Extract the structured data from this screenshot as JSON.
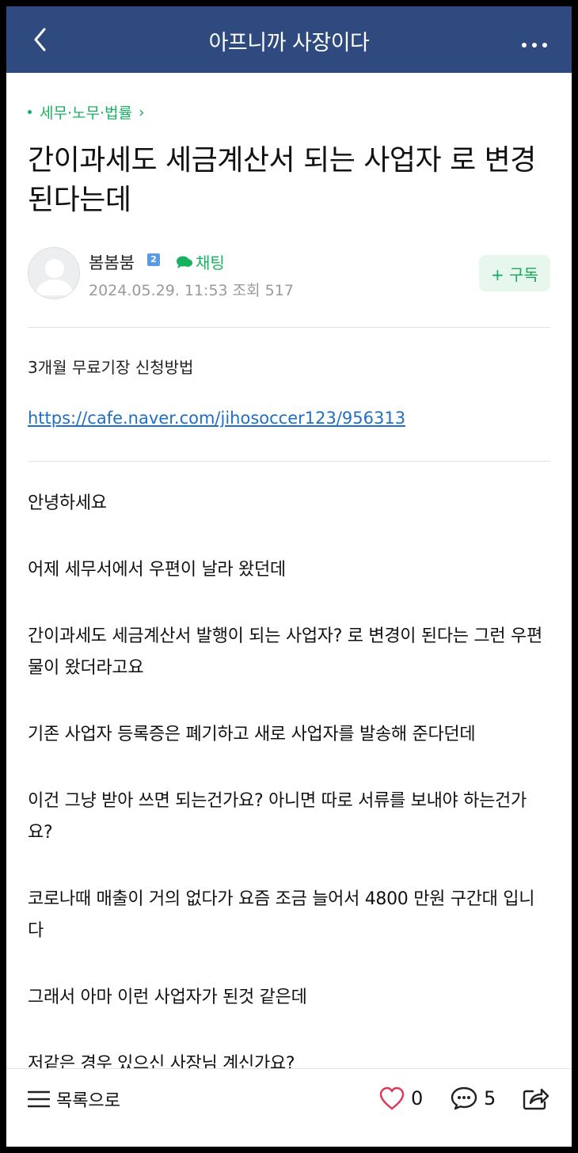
{
  "header": {
    "title": "아프니까 사장이다",
    "back_icon": "chevron-left-icon",
    "more_icon": "more-horizontal-icon",
    "bg_color": "#2f4a7e"
  },
  "post": {
    "category": "세무·노무·법률",
    "title": "간이과세도 세금계산서 되는 사업자 로 변경된다는데",
    "author": {
      "name": "봄봄붐",
      "level": "2",
      "chat_label": "채팅",
      "date": "2024.05.29. 11:53",
      "views": "조회 517"
    },
    "subscribe_label": "+ 구독",
    "notice_text": "3개월 무료기장 신청방법",
    "notice_link": "https://cafe.naver.com/jihosoccer123/956313",
    "paragraphs": [
      "안녕하세요",
      "어제 세무서에서 우편이 날라 왔던데",
      "간이과세도 세금계산서 발행이 되는 사업자? 로 변경이 된다는 그런 우편물이 왔더라고요",
      "기존 사업자 등록증은 폐기하고 새로 사업자를 발송해 준다던데",
      "이건 그냥 받아 쓰면 되는건가요? 아니면  따로 서류를 보내야 하는건가요?",
      "코로나때 매출이 거의 없다가 요즘 조금 늘어서 4800 만원 구간대 입니다",
      "그래서 아마  이런 사업자가 된것 같은데",
      "저같은 경우 있으신 사장님 계신가요?"
    ]
  },
  "bottom": {
    "list_label": "목록으로",
    "likes": "0",
    "comments": "5",
    "icons": [
      "menu-icon",
      "heart-icon",
      "comment-icon",
      "share-icon"
    ]
  },
  "colors": {
    "accent_green": "#17b25f",
    "link_blue": "#1f6fc4"
  }
}
